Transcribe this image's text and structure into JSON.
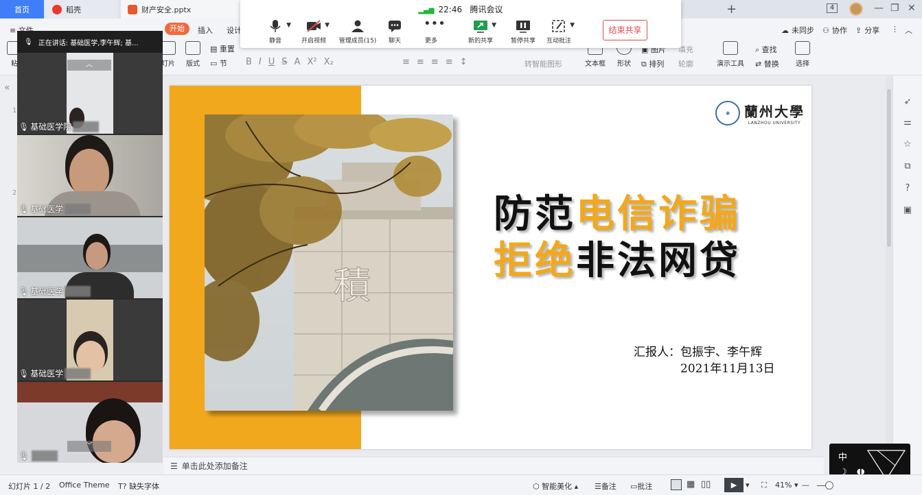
{
  "tabs": {
    "home": "首页",
    "daoke": "稻壳",
    "doc": "财产安全.pptx",
    "tab_count": "4"
  },
  "ribbon": {
    "file": "文件",
    "start": "开始",
    "insert": "插入",
    "design": "设计",
    "reset": "重置",
    "new_slide": "灯片",
    "layout": "版式",
    "section": "节",
    "convert_smartart": "转智能图形",
    "textbox": "文本框",
    "shape": "形状",
    "arrange": "排列",
    "outline": "轮廓",
    "fill": "填充",
    "image": "图片",
    "present_tool": "演示工具",
    "find": "查找",
    "replace": "替换",
    "select": "选择",
    "unsync": "未同步",
    "collab": "协作",
    "share": "分享",
    "paste": "粘"
  },
  "meeting": {
    "time": "22:46",
    "app": "腾讯会议",
    "mute": "静音",
    "video": "开启视频",
    "members": "管理成员(15)",
    "chat": "聊天",
    "more": "更多",
    "new_share": "新的共享",
    "pause_share": "暂停共享",
    "annotate": "互动批注",
    "end_share": "结束共享"
  },
  "videos": {
    "speaking": "正在讲话: 基础医学,李午辉; 基...",
    "participants": [
      {
        "name": "基础医学院"
      },
      {
        "name": "基础医学"
      },
      {
        "name": "基础医学"
      },
      {
        "name": "基础医学"
      },
      {
        "name": ""
      }
    ]
  },
  "slide": {
    "logo_cn": "蘭州大學",
    "logo_en": "LANZHOU UNIVERSITY",
    "photo_char": "積",
    "line1_black": "防范",
    "line1_gold": "电信诈骗",
    "line2_gold": "拒绝",
    "line2_black": "非法网贷",
    "reporter": "汇报人：包振宇、李午辉",
    "date": "2021年11月13日"
  },
  "notes": {
    "placeholder": "单击此处添加备注"
  },
  "ime": {
    "lang": "中"
  },
  "statusbar": {
    "slide_info": "幻灯片 1 / 2",
    "theme": "Office Theme",
    "missing_font": "缺失字体",
    "beautify": "智能美化",
    "notes": "备注",
    "comments": "批注",
    "zoom": "41%"
  },
  "thumbs": {
    "n1": "1",
    "n2": "2"
  },
  "colors": {
    "accent_gold": "#f2a81d",
    "home_tab": "#3f7ef6",
    "start_pill": "#ef6a3e",
    "end_share": "#e64a4a"
  }
}
